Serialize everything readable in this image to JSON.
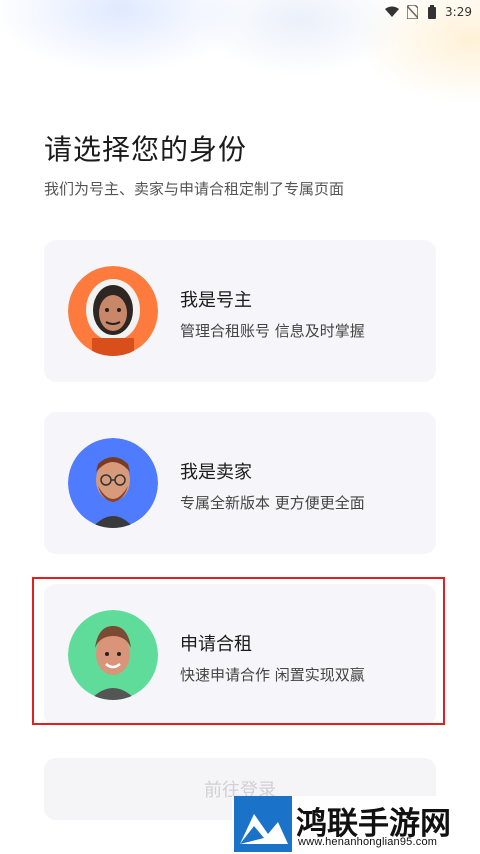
{
  "status_bar": {
    "time": "3:29",
    "icons": [
      "wifi-icon",
      "no-sim-icon",
      "battery-icon"
    ]
  },
  "header": {
    "title": "请选择您的身份",
    "subtitle": "我们为号主、卖家与申请合租定制了专属页面"
  },
  "roles": [
    {
      "title": "我是号主",
      "desc": "管理合租账号 信息及时掌握",
      "avatar": "astronaut-avatar",
      "avatar_bg": "#ff7a3d"
    },
    {
      "title": "我是卖家",
      "desc": "专属全新版本 更方便更全面",
      "avatar": "bearded-man-avatar",
      "avatar_bg": "#4f7cff"
    },
    {
      "title": "申请合租",
      "desc": "快速申请合作 闲置实现双赢",
      "avatar": "young-man-avatar",
      "avatar_bg": "#5fdc9a"
    }
  ],
  "login_button": {
    "label": "前往登录"
  },
  "watermark": {
    "name": "鸿联手游网",
    "url": "www.henanhonglian95.com"
  },
  "colors": {
    "highlight": "#e02020",
    "card_bg": "#f6f6fa"
  }
}
